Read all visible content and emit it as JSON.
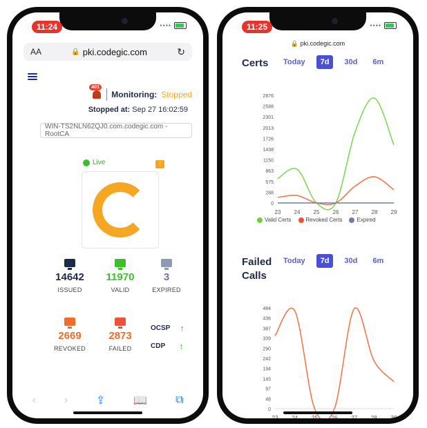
{
  "left_phone": {
    "status_time": "11:24",
    "browser": {
      "text_size": "AA",
      "url": "pki.codegic.com",
      "lock": "🔒",
      "reload": "↻"
    },
    "monitoring": {
      "badge": "401",
      "label": "Monitoring:",
      "value": "Stopped"
    },
    "stopped_at": {
      "label": "Stopped at:",
      "value": "Sep 27 16:02:59"
    },
    "host": "WIN-TS2NLN62QJ0.com.codegic.com - RootCA",
    "live_label": "Live",
    "flag_glyph": "!",
    "stats": [
      {
        "num": "14642",
        "label": "ISSUED",
        "color": "#1e2a4a"
      },
      {
        "num": "11970",
        "label": "VALID",
        "color": "#3bbf2a"
      },
      {
        "num": "3",
        "label": "EXPIRED",
        "color": "#6b7a96"
      },
      {
        "num": "2669",
        "label": "REVOKED",
        "color": "#f26b2a"
      },
      {
        "num": "2873",
        "label": "FAILED",
        "color": "#f26b2a"
      }
    ],
    "protocols": [
      {
        "label": "OCSP",
        "arrow": "↑"
      },
      {
        "label": "CDP",
        "arrow": "↑"
      }
    ],
    "bottom_icons": {
      "back": "‹",
      "forward": "›",
      "share": "⇪",
      "bookmarks": "📖",
      "tabs": "⧉"
    }
  },
  "right_phone": {
    "status_time": "11:25",
    "url": "pki.codegic.com",
    "lock": "🔒",
    "certs_title": "Certs",
    "failed_title_1": "Failed",
    "failed_title_2": "Calls",
    "tabs": [
      "Today",
      "7d",
      "30d",
      "6m"
    ],
    "active_tab": "7d",
    "legend": [
      "Valid Certs",
      "Revoked Certs",
      "Expired"
    ]
  },
  "colors": {
    "green": "#7ed957",
    "orange": "#f2774a",
    "slate": "#6b7fa6",
    "brand_blue": "#4b4fd6"
  },
  "chart_data": [
    {
      "type": "line",
      "title": "Certs",
      "x": [
        23,
        24,
        25,
        26,
        27,
        28,
        29
      ],
      "yticks": [
        0,
        288,
        575,
        863,
        1150,
        1438,
        1726,
        2013,
        2301,
        2588,
        2876
      ],
      "ylim": [
        0,
        2876
      ],
      "series": [
        {
          "name": "Valid Certs",
          "color": "#7ed957",
          "values": [
            650,
            900,
            0,
            0,
            1900,
            2800,
            1550
          ]
        },
        {
          "name": "Revoked Certs",
          "color": "#f2774a",
          "values": [
            150,
            200,
            0,
            0,
            450,
            700,
            350
          ]
        },
        {
          "name": "Expired",
          "color": "#6b7fa6",
          "values": [
            0,
            0,
            0,
            0,
            0,
            0,
            0
          ]
        }
      ],
      "legend": "bottom"
    },
    {
      "type": "line",
      "title": "Failed Calls",
      "x": [
        23,
        24,
        25,
        26,
        27,
        28,
        29
      ],
      "yticks": [
        0,
        48,
        97,
        145,
        194,
        242,
        290,
        339,
        387,
        436,
        484
      ],
      "ylim": [
        0,
        484
      ],
      "series": [
        {
          "color": "#f2774a",
          "values": [
            350,
            470,
            0,
            0,
            480,
            230,
            130
          ]
        }
      ]
    }
  ]
}
